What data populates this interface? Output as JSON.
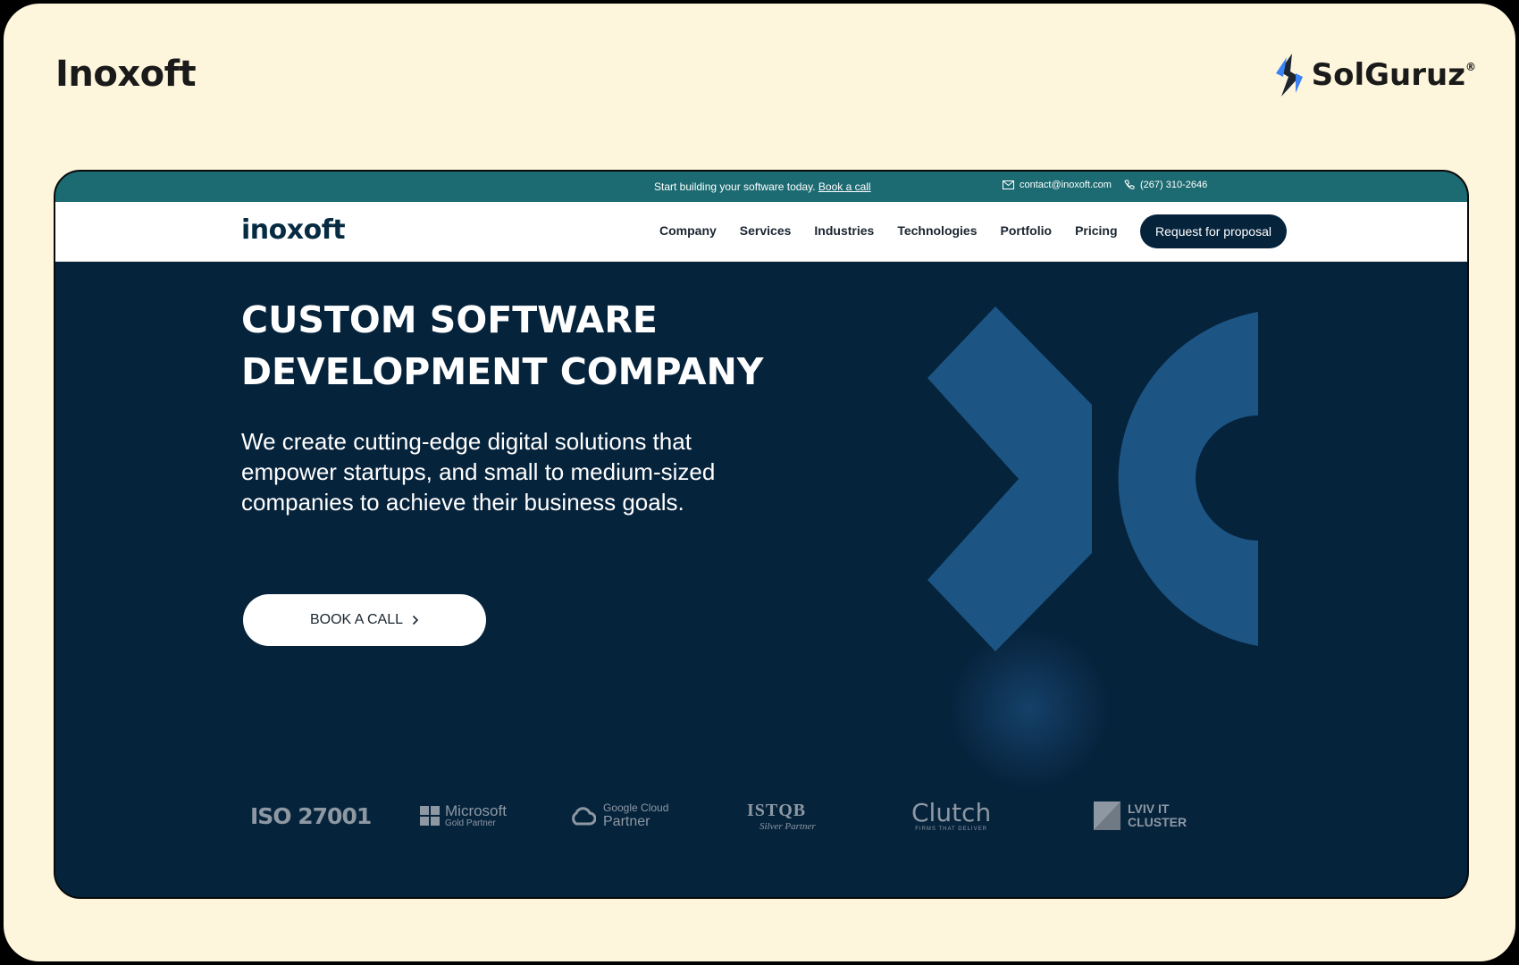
{
  "slide": {
    "title": "Inoxoft",
    "brand": "SolGuruz",
    "brand_mark": "®"
  },
  "topbar": {
    "promo_text": "Start building your software today.",
    "promo_link": "Book a call",
    "email": "contact@inoxoft.com",
    "phone": "(267) 310-2646"
  },
  "navbar": {
    "logo": "inoxoft",
    "items": [
      "Company",
      "Services",
      "Industries",
      "Technologies",
      "Portfolio",
      "Pricing"
    ],
    "cta": "Request for proposal"
  },
  "hero": {
    "heading_line1": "CUSTOM SOFTWARE",
    "heading_line2": "DEVELOPMENT COMPANY",
    "description": "We create cutting-edge digital solutions that empower startups, and small to medium-sized companies to achieve their business goals.",
    "cta": "BOOK A CALL",
    "cta_icon": "chevron-right-icon"
  },
  "badges": {
    "iso": "ISO 27001",
    "microsoft_1": "Microsoft",
    "microsoft_2": "Gold Partner",
    "google_1": "Google Cloud",
    "google_2": "Partner",
    "istqb_1": "ISTQB",
    "istqb_2": "Silver Partner",
    "clutch_1": "Clutch",
    "clutch_2": "FIRMS THAT DELIVER",
    "lviv_1": "LVIV IT",
    "lviv_2": "CLUSTER"
  },
  "colors": {
    "background": "#fdf6dc",
    "topbar": "#1d6b72",
    "hero": "#06233c",
    "mark": "#1c5584"
  }
}
